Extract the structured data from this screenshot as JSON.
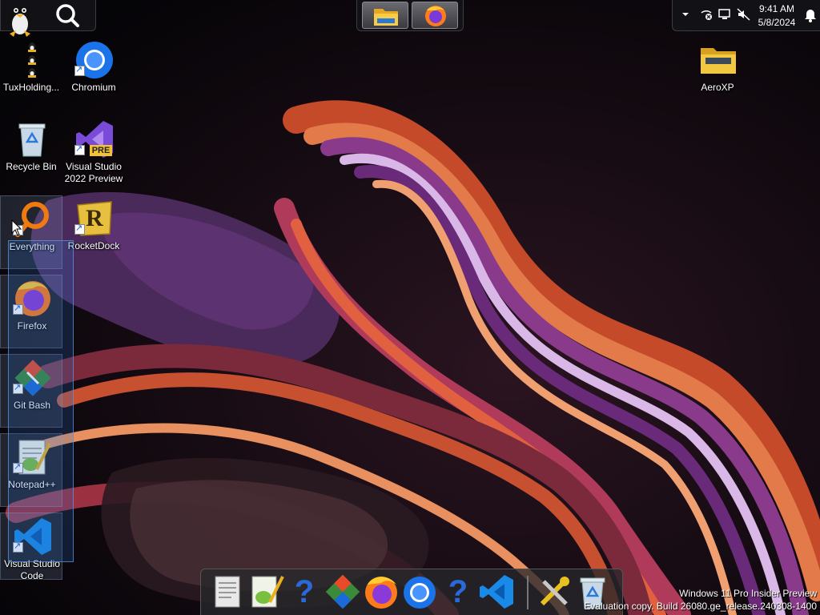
{
  "desktop": {
    "icons": [
      {
        "label": "TuxHolding...",
        "icon": "tux-holding-icon"
      },
      {
        "label": "Chromium",
        "icon": "chromium-icon"
      },
      {
        "label": "Recycle Bin",
        "icon": "recycle-bin-icon"
      },
      {
        "label": "Visual Studio 2022 Preview",
        "icon": "visual-studio-preview-icon",
        "badge": "PRE"
      },
      {
        "label": "Everything",
        "icon": "everything-search-icon"
      },
      {
        "label": "RocketDock",
        "icon": "rocketdock-icon",
        "glyph": "R"
      },
      {
        "label": "Firefox",
        "icon": "firefox-icon"
      },
      {
        "label": "Git Bash",
        "icon": "git-bash-icon"
      },
      {
        "label": "Notepad++",
        "icon": "notepad-plus-plus-icon"
      },
      {
        "label": "Visual Studio Code",
        "icon": "vscode-icon"
      },
      {
        "label": "AeroXP",
        "icon": "folder-icon"
      }
    ]
  },
  "top_left_panel": {
    "icons": [
      "tux-penguin-icon",
      "search-icon"
    ]
  },
  "quick_launch": {
    "items": [
      "file-explorer-icon",
      "firefox-icon"
    ]
  },
  "system_tray": {
    "icons": [
      "chevron-up-icon",
      "network-disconnected-icon",
      "display-icon",
      "volume-mute-icon",
      "notification-bell-icon"
    ],
    "time": "9:41 AM",
    "date": "5/8/2024"
  },
  "dock": {
    "items": [
      {
        "name": "text-document-icon"
      },
      {
        "name": "notepad-plus-plus-icon"
      },
      {
        "name": "help-icon",
        "glyph": "?"
      },
      {
        "name": "git-icon"
      },
      {
        "name": "firefox-icon"
      },
      {
        "name": "chromium-icon"
      },
      {
        "name": "help-icon",
        "glyph": "?"
      },
      {
        "name": "vscode-icon"
      },
      {
        "name": "tools-icon"
      },
      {
        "name": "recycle-bin-icon"
      }
    ]
  },
  "watermark": {
    "line1": "Windows 11 Pro Insider Preview",
    "line2": "Evaluation copy. Build 26080.ge_release.240308-1400"
  },
  "colors": {
    "background": "#07060a",
    "selection": "#2d6ec8",
    "accent_orange": "#e8612c",
    "accent_purple": "#6b3a8a"
  }
}
